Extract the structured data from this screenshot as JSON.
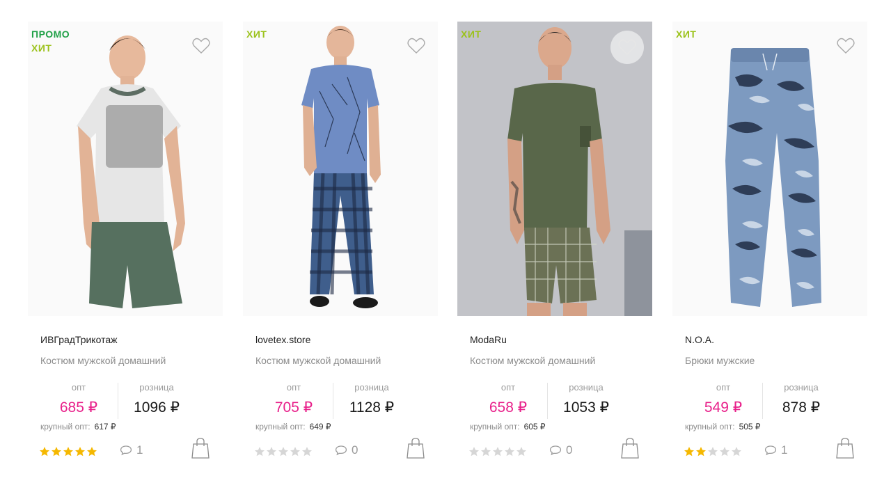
{
  "colors": {
    "opt_price": "#e8208a",
    "badge_promo": "#1fa046",
    "badge_hit": "#9bc21a",
    "star_filled": "#f5b800",
    "star_empty": "#d6d6d6"
  },
  "labels": {
    "opt": "опт",
    "retail": "розница",
    "bulk": "крупный опт:"
  },
  "icons": {
    "favorite": "heart-icon",
    "comments": "comment-icon",
    "cart": "shopping-bag-icon",
    "rating": "star-icon"
  },
  "products": [
    {
      "badges": [
        "ПРОМО",
        "ХИТ"
      ],
      "brand": "ИВГрадТрикотаж",
      "title": "Костюм мужской домашний",
      "opt_price": "685 ₽",
      "retail_price": "1096 ₽",
      "bulk_price": "617 ₽",
      "rating": 5,
      "comments": "1",
      "fav_hover": false
    },
    {
      "badges": [
        "ХИТ"
      ],
      "brand": "lovetex.store",
      "title": "Костюм мужской домашний",
      "opt_price": "705 ₽",
      "retail_price": "1128 ₽",
      "bulk_price": "649 ₽",
      "rating": 0,
      "comments": "0",
      "fav_hover": false
    },
    {
      "badges": [
        "ХИТ"
      ],
      "brand": "ModaRu",
      "title": "Костюм мужской домашний",
      "opt_price": "658 ₽",
      "retail_price": "1053 ₽",
      "bulk_price": "605 ₽",
      "rating": 0,
      "comments": "0",
      "fav_hover": true
    },
    {
      "badges": [
        "ХИТ"
      ],
      "brand": "N.O.A.",
      "title": "Брюки мужские",
      "opt_price": "549 ₽",
      "retail_price": "878 ₽",
      "bulk_price": "505 ₽",
      "rating": 2,
      "comments": "1",
      "fav_hover": false
    }
  ]
}
